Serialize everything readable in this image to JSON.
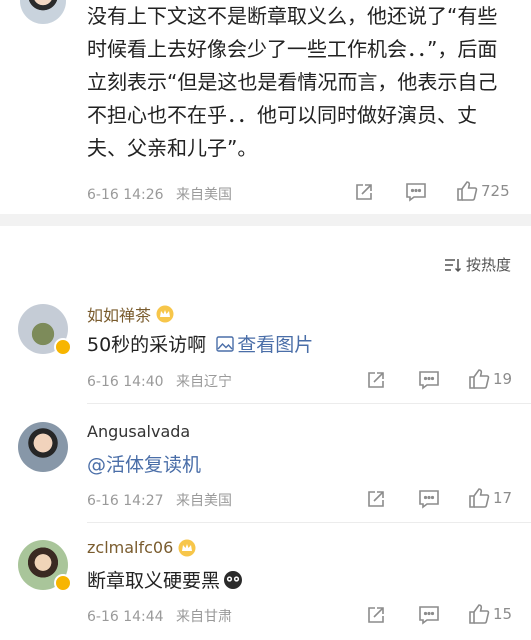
{
  "top_post": {
    "text": "没有上下文这不是断章取义么，他还说了“有些时候看上去好像会少了一些工作机会．．”，后面立刻表示“但是这也是看情况而言，他表示自己不担心也不在乎．．他可以同时做好演员、丈夫、父亲和儿子”。",
    "date": "6-16 14:26",
    "location": "来自美国",
    "likes": "725"
  },
  "sort": {
    "label": "按热度"
  },
  "comments": [
    {
      "username": "如如禅茶",
      "text": "50秒的采访啊",
      "view_image": "查看图片",
      "date": "6-16 14:40",
      "location": "来自辽宁",
      "likes": "19"
    },
    {
      "username": "Angusalvada",
      "text": "@活体复读机",
      "date": "6-16 14:27",
      "location": "来自美国",
      "likes": "17"
    },
    {
      "username": "zclmalfc06",
      "text": "断章取义硬要黑",
      "date": "6-16 14:44",
      "location": "来自甘肃",
      "likes": "15"
    }
  ],
  "icons": {
    "share": "share-icon",
    "comment": "comment-icon",
    "like": "like-icon",
    "sort": "sort-icon",
    "crown": "crown-badge-icon",
    "emoji": "emoji-icon"
  },
  "colors": {
    "link": "#4a6ea8",
    "meta": "#9a9a9a",
    "vip_name": "#7a5c2e",
    "badge": "#f7b500"
  }
}
